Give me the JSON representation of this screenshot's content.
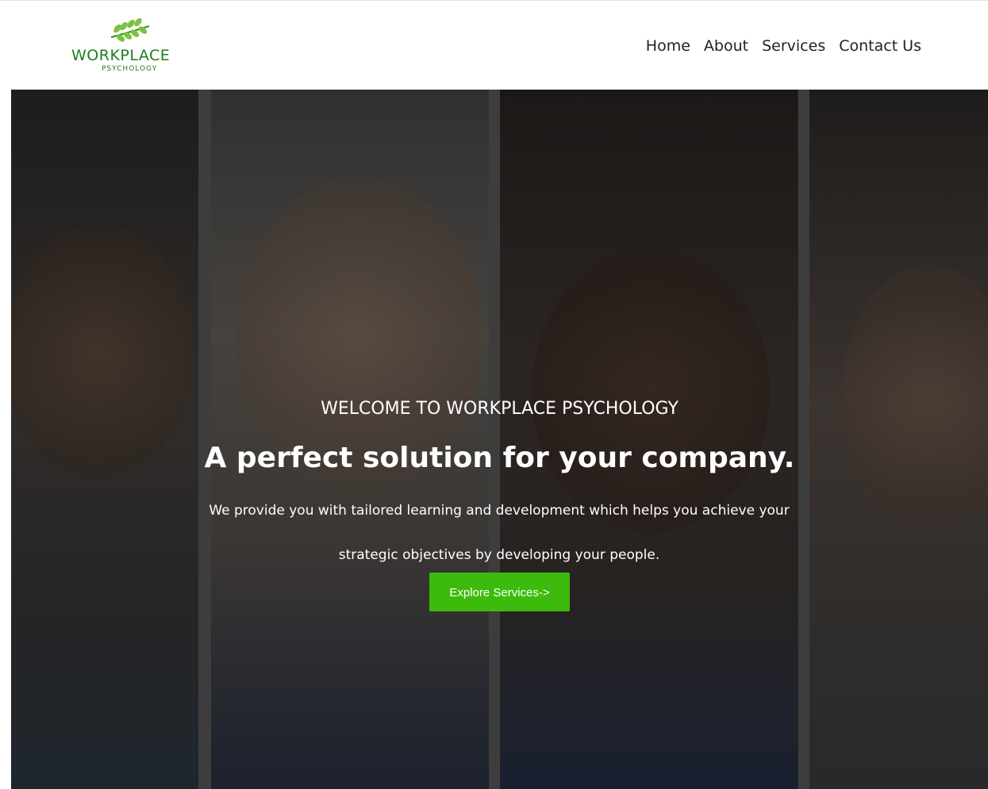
{
  "brand": {
    "name": "WORKPLACE",
    "tagline": "PSYCHOLOGY",
    "logo_icon": "leaf-icon",
    "color": "#1e7d1e",
    "leaf_color": "#7cc242"
  },
  "nav": {
    "items": [
      {
        "label": "Home"
      },
      {
        "label": "About"
      },
      {
        "label": "Services"
      },
      {
        "label": "Contact Us"
      }
    ]
  },
  "hero": {
    "kicker": "WELCOME TO WORKPLACE PSYCHOLOGY",
    "headline": "A perfect solution for your company.",
    "description": "We provide you with tailored learning and development which helps you achieve your strategic objectives by developing your people.",
    "cta_label": "Explore Services->",
    "cta_color": "#3dbb0d"
  }
}
